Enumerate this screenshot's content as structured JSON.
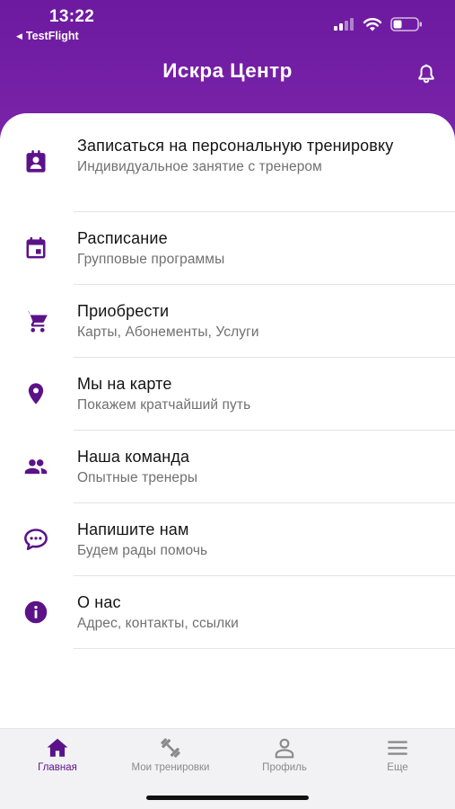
{
  "status_bar": {
    "time": "13:22",
    "back_app": "TestFlight"
  },
  "header": {
    "title": "Искра Центр"
  },
  "menu": [
    {
      "id": "personal-training",
      "icon": "contact-calendar-icon",
      "title": "Записаться на персональную тренировку",
      "subtitle": "Индивидуальное занятие с тренером"
    },
    {
      "id": "schedule",
      "icon": "calendar-icon",
      "title": "Расписание",
      "subtitle": "Групповые программы"
    },
    {
      "id": "purchase",
      "icon": "cart-icon",
      "title": "Приобрести",
      "subtitle": "Карты, Абонементы, Услуги"
    },
    {
      "id": "map",
      "icon": "location-pin-icon",
      "title": "Мы на карте",
      "subtitle": "Покажем кратчайший путь"
    },
    {
      "id": "team",
      "icon": "people-icon",
      "title": "Наша команда",
      "subtitle": "Опытные тренеры"
    },
    {
      "id": "contact",
      "icon": "chat-bubble-icon",
      "title": "Напишите нам",
      "subtitle": "Будем рады помочь"
    },
    {
      "id": "about",
      "icon": "info-icon",
      "title": "О нас",
      "subtitle": "Адрес, контакты, ссылки"
    }
  ],
  "tabs": [
    {
      "id": "home",
      "icon": "home-icon",
      "label": "Главная",
      "active": true
    },
    {
      "id": "my-trainings",
      "icon": "dumbbell-icon",
      "label": "Мои тренировки",
      "active": false
    },
    {
      "id": "profile",
      "icon": "person-icon",
      "label": "Профиль",
      "active": false
    },
    {
      "id": "more",
      "icon": "menu-icon",
      "label": "Еще",
      "active": false
    }
  ],
  "colors": {
    "header_purple": "#6d1aa0",
    "icon_purple": "#5b1289",
    "subtitle_gray": "#707070",
    "tab_inactive": "#8a8a8f"
  }
}
